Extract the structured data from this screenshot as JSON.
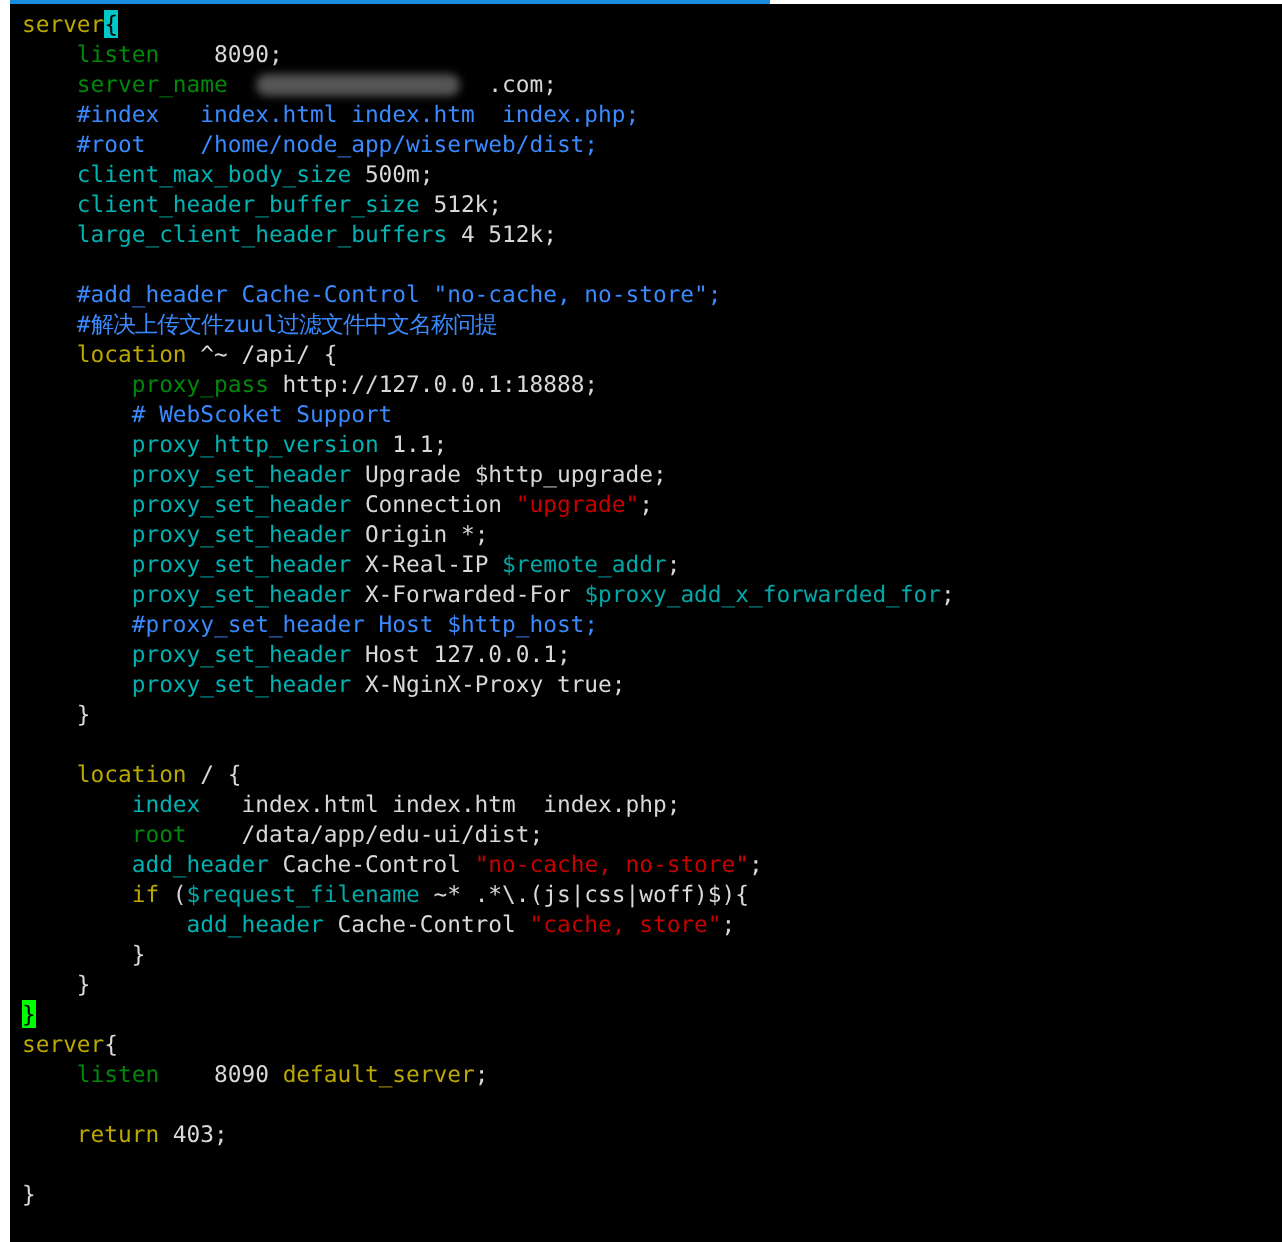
{
  "lines": [
    {
      "segments": [
        {
          "kind": "keyword",
          "text": "server"
        },
        {
          "kind": "cursor",
          "text": "{"
        }
      ]
    },
    {
      "segments": [
        {
          "kind": "directive",
          "text": "    listen"
        },
        {
          "kind": "plain",
          "text": "    8090;"
        }
      ]
    },
    {
      "segments": [
        {
          "kind": "directive",
          "text": "    server_name"
        },
        {
          "kind": "redacted"
        },
        {
          "kind": "plain",
          "text": ".com;"
        }
      ]
    },
    {
      "segments": [
        {
          "kind": "comment",
          "text": "    #index   index.html index.htm  index.php;"
        }
      ]
    },
    {
      "segments": [
        {
          "kind": "comment",
          "text": "    #root    /home/node_app/wiserweb/dist;"
        }
      ]
    },
    {
      "segments": [
        {
          "kind": "setting",
          "text": "    client_max_body_size"
        },
        {
          "kind": "plain",
          "text": " 500m;"
        }
      ]
    },
    {
      "segments": [
        {
          "kind": "setting",
          "text": "    client_header_buffer_size"
        },
        {
          "kind": "plain",
          "text": " 512k;"
        }
      ]
    },
    {
      "segments": [
        {
          "kind": "setting",
          "text": "    large_client_header_buffers"
        },
        {
          "kind": "plain",
          "text": " 4 512k;"
        }
      ]
    },
    {
      "kind": "blank"
    },
    {
      "segments": [
        {
          "kind": "comment",
          "text": "    #add_header Cache-Control \"no-cache, no-store\";"
        }
      ]
    },
    {
      "segments": [
        {
          "kind": "comment",
          "text": "    #解决上传文件zuul过滤文件中文名称问提"
        }
      ]
    },
    {
      "segments": [
        {
          "kind": "keyword",
          "text": "    location"
        },
        {
          "kind": "plain",
          "text": " ^~ /api/ {"
        }
      ]
    },
    {
      "segments": [
        {
          "kind": "directive",
          "text": "        proxy_pass"
        },
        {
          "kind": "plain",
          "text": " http://127.0.0.1:18888;"
        }
      ]
    },
    {
      "segments": [
        {
          "kind": "comment",
          "text": "        # WebScoket Support"
        }
      ]
    },
    {
      "segments": [
        {
          "kind": "setting",
          "text": "        proxy_http_version"
        },
        {
          "kind": "plain",
          "text": " 1.1;"
        }
      ]
    },
    {
      "segments": [
        {
          "kind": "setting",
          "text": "        proxy_set_header"
        },
        {
          "kind": "plain",
          "text": " Upgrade $http_upgrade;"
        }
      ]
    },
    {
      "segments": [
        {
          "kind": "setting",
          "text": "        proxy_set_header"
        },
        {
          "kind": "plain",
          "text": " Connection "
        },
        {
          "kind": "string",
          "text": "\"upgrade\""
        },
        {
          "kind": "plain",
          "text": ";"
        }
      ]
    },
    {
      "segments": [
        {
          "kind": "setting",
          "text": "        proxy_set_header"
        },
        {
          "kind": "plain",
          "text": " Origin *;"
        }
      ]
    },
    {
      "segments": [
        {
          "kind": "setting",
          "text": "        proxy_set_header"
        },
        {
          "kind": "plain",
          "text": " X-Real-IP "
        },
        {
          "kind": "variable",
          "text": "$remote_addr"
        },
        {
          "kind": "plain",
          "text": ";"
        }
      ]
    },
    {
      "segments": [
        {
          "kind": "setting",
          "text": "        proxy_set_header"
        },
        {
          "kind": "plain",
          "text": " X-Forwarded-For "
        },
        {
          "kind": "variable",
          "text": "$proxy_add_x_forwarded_for"
        },
        {
          "kind": "plain",
          "text": ";"
        }
      ]
    },
    {
      "segments": [
        {
          "kind": "comment",
          "text": "        #proxy_set_header Host $http_host;"
        }
      ]
    },
    {
      "segments": [
        {
          "kind": "setting",
          "text": "        proxy_set_header"
        },
        {
          "kind": "plain",
          "text": " Host 127.0.0.1;"
        }
      ]
    },
    {
      "segments": [
        {
          "kind": "setting",
          "text": "        proxy_set_header"
        },
        {
          "kind": "plain",
          "text": " X-NginX-Proxy true;"
        }
      ]
    },
    {
      "segments": [
        {
          "kind": "plain",
          "text": "    }"
        }
      ]
    },
    {
      "kind": "blank"
    },
    {
      "segments": [
        {
          "kind": "keyword",
          "text": "    location"
        },
        {
          "kind": "plain",
          "text": " / {"
        }
      ]
    },
    {
      "segments": [
        {
          "kind": "setting",
          "text": "        index"
        },
        {
          "kind": "plain",
          "text": "   index.html index.htm  index.php;"
        }
      ]
    },
    {
      "segments": [
        {
          "kind": "directive",
          "text": "        root"
        },
        {
          "kind": "plain",
          "text": "    /data/app/edu-ui/dist;"
        }
      ]
    },
    {
      "segments": [
        {
          "kind": "setting",
          "text": "        add_header"
        },
        {
          "kind": "plain",
          "text": " Cache-Control "
        },
        {
          "kind": "string",
          "text": "\"no-cache, no-store\""
        },
        {
          "kind": "plain",
          "text": ";"
        }
      ]
    },
    {
      "segments": [
        {
          "kind": "keyword",
          "text": "        if"
        },
        {
          "kind": "plain",
          "text": " ("
        },
        {
          "kind": "variable",
          "text": "$request_filename"
        },
        {
          "kind": "plain",
          "text": " ~* .*\\.(js|css|woff)$){"
        }
      ]
    },
    {
      "segments": [
        {
          "kind": "setting",
          "text": "            add_header"
        },
        {
          "kind": "plain",
          "text": " Cache-Control "
        },
        {
          "kind": "string",
          "text": "\"cache, store\""
        },
        {
          "kind": "plain",
          "text": ";"
        }
      ]
    },
    {
      "segments": [
        {
          "kind": "plain",
          "text": "        }"
        }
      ]
    },
    {
      "segments": [
        {
          "kind": "plain",
          "text": "    }"
        }
      ]
    },
    {
      "segments": [
        {
          "kind": "match",
          "text": "}"
        }
      ]
    },
    {
      "segments": [
        {
          "kind": "keyword",
          "text": "server"
        },
        {
          "kind": "plain",
          "text": "{"
        }
      ]
    },
    {
      "segments": [
        {
          "kind": "directive",
          "text": "    listen"
        },
        {
          "kind": "plain",
          "text": "    8090 "
        },
        {
          "kind": "keyword",
          "text": "default_server"
        },
        {
          "kind": "plain",
          "text": ";"
        }
      ]
    },
    {
      "kind": "blank"
    },
    {
      "segments": [
        {
          "kind": "keyword",
          "text": "    return"
        },
        {
          "kind": "plain",
          "text": " 403;"
        }
      ]
    },
    {
      "kind": "blank"
    },
    {
      "segments": [
        {
          "kind": "plain",
          "text": "}"
        }
      ]
    }
  ]
}
